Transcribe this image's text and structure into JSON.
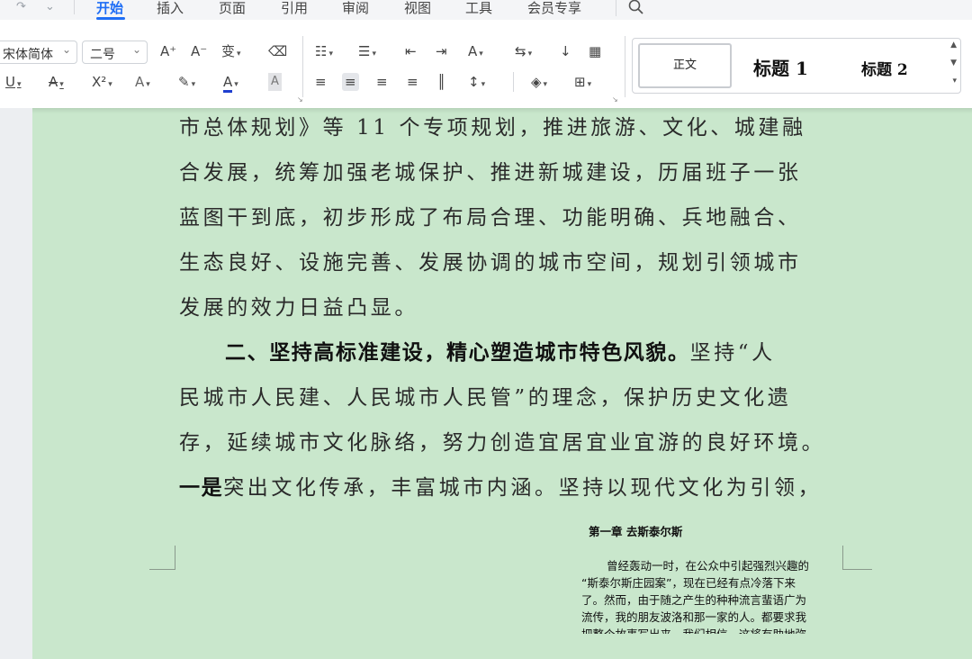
{
  "menu": {
    "tabs": [
      "开始",
      "插入",
      "页面",
      "引用",
      "审阅",
      "视图",
      "工具",
      "会员专享"
    ]
  },
  "toolbar": {
    "font_name": "宋体简体",
    "font_size": "二号",
    "increase_font": "A⁺",
    "decrease_font": "A⁻",
    "phonetic": "变",
    "clear_format": "⌫",
    "underline": "U",
    "strike": "A",
    "superscript": "X²",
    "text_effect": "A",
    "highlight": "✎",
    "font_color": "A",
    "char_shade": "A",
    "bullets": "☷",
    "numbering": "☰",
    "outdent": "⇤",
    "indent": "⇥",
    "char_spacing": "A",
    "para_direction": "⇆",
    "sort": "↓",
    "table_layout": "▦",
    "align_left": "≡",
    "align_center": "≡",
    "align_right": "≡",
    "justify": "≡",
    "distributed": "║",
    "line_spacing": "↕",
    "shading": "◈",
    "borders": "⊞"
  },
  "styles": {
    "normal": "正文",
    "heading1": "标题 1",
    "heading2": "标题 2"
  },
  "document": {
    "line1": "市总体规划》等 11 个专项规划，推进旅游、文化、城建融",
    "line2": "合发展，统筹加强老城保护、推进新城建设，历届班子一张",
    "line3": "蓝图干到底，初步形成了布局合理、功能明确、兵地融合、",
    "line4": "生态良好、设施完善、发展协调的城市空间，规划引领城市",
    "line5": "发展的效力日益凸显。",
    "line6_bold": "二、坚持高标准建设，精心塑造城市特色风貌。",
    "line6_rest": "坚持“人",
    "line7": "民城市人民建、人民城市人民管”的理念，保护历史文化遗",
    "line8": "存，延续城市文化脉络，努力创造宜居宜业宜游的良好环境。",
    "line9_bold": "一是",
    "line9_rest": "突出文化传承，丰富城市内涵。坚持以现代文化为引领，"
  },
  "next_page": {
    "chapter": "第一章  去斯泰尔斯",
    "lines": [
      "曾经轰动一时，在公众中引起强烈兴趣的",
      "“斯泰尔斯庄园案”，现在已经有点冷落下来",
      "了。然而，由于随之产生的种种流言蜚语广为",
      "流传，我的朋友波洛和那一家的人。都要求我",
      "把整个故事写出来，我们相信，这将有助地弥"
    ]
  },
  "colors": {
    "accent": "#1f6ef5",
    "page_background": "#c9e7cc",
    "font_color_underline": "#1f3fcf"
  }
}
